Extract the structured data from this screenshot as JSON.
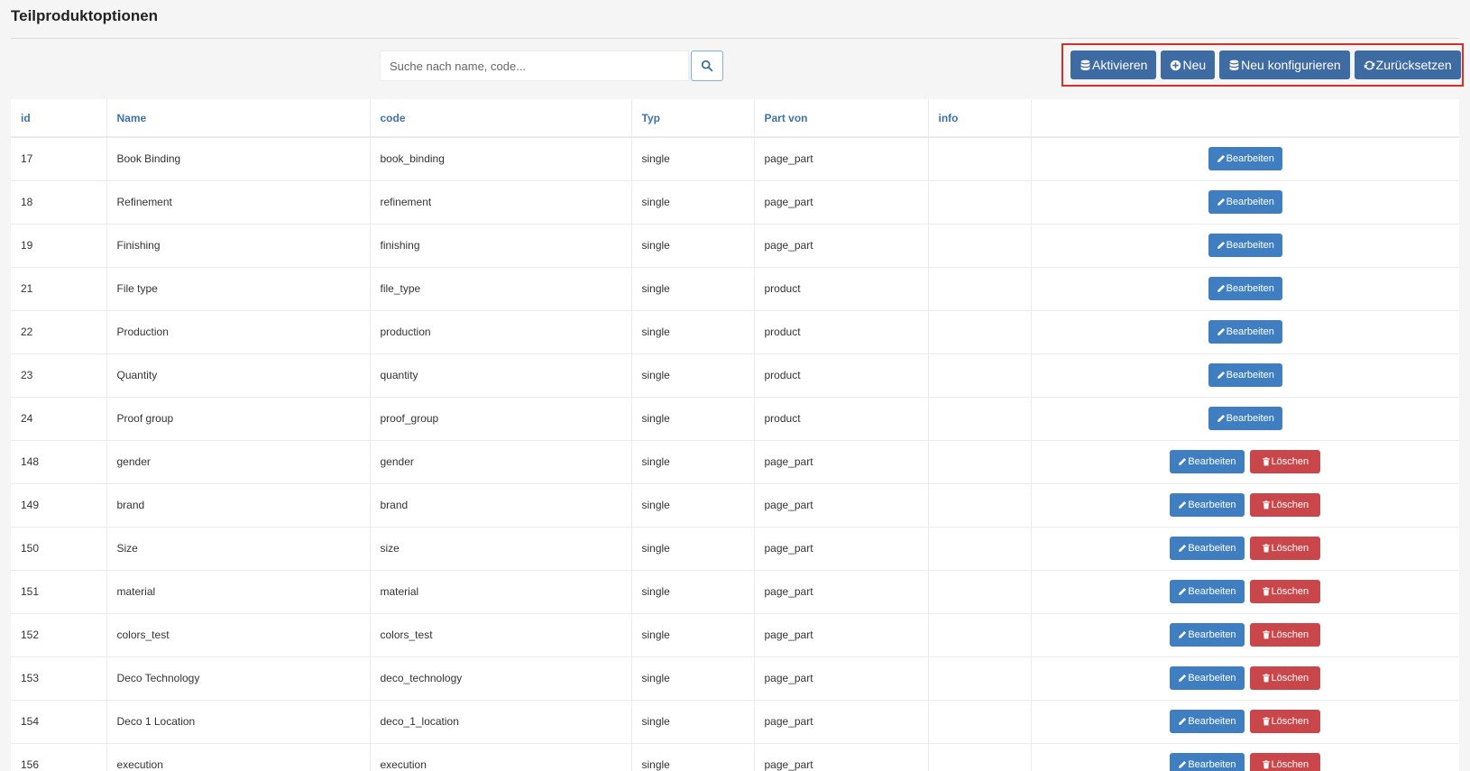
{
  "page": {
    "title": "Teilproduktoptionen"
  },
  "search": {
    "placeholder": "Suche nach name, code..."
  },
  "actions": {
    "activate": "Aktivieren",
    "new": "Neu",
    "reconfigure": "Neu konfigurieren",
    "reset": "Zurücksetzen"
  },
  "table": {
    "headers": [
      "id",
      "Name",
      "code",
      "Typ",
      "Part von",
      "info",
      ""
    ],
    "edit_label": "Bearbeiten",
    "delete_label": "Löschen",
    "rows": [
      {
        "id": "17",
        "name": "Book Binding",
        "code": "book_binding",
        "type": "single",
        "part": "page_part",
        "info": "",
        "deletable": false
      },
      {
        "id": "18",
        "name": "Refinement",
        "code": "refinement",
        "type": "single",
        "part": "page_part",
        "info": "",
        "deletable": false
      },
      {
        "id": "19",
        "name": "Finishing",
        "code": "finishing",
        "type": "single",
        "part": "page_part",
        "info": "",
        "deletable": false
      },
      {
        "id": "21",
        "name": "File type",
        "code": "file_type",
        "type": "single",
        "part": "product",
        "info": "",
        "deletable": false
      },
      {
        "id": "22",
        "name": "Production",
        "code": "production",
        "type": "single",
        "part": "product",
        "info": "",
        "deletable": false
      },
      {
        "id": "23",
        "name": "Quantity",
        "code": "quantity",
        "type": "single",
        "part": "product",
        "info": "",
        "deletable": false
      },
      {
        "id": "24",
        "name": "Proof group",
        "code": "proof_group",
        "type": "single",
        "part": "product",
        "info": "",
        "deletable": false
      },
      {
        "id": "148",
        "name": "gender",
        "code": "gender",
        "type": "single",
        "part": "page_part",
        "info": "",
        "deletable": true
      },
      {
        "id": "149",
        "name": "brand",
        "code": "brand",
        "type": "single",
        "part": "page_part",
        "info": "",
        "deletable": true
      },
      {
        "id": "150",
        "name": "Size",
        "code": "size",
        "type": "single",
        "part": "page_part",
        "info": "",
        "deletable": true
      },
      {
        "id": "151",
        "name": "material",
        "code": "material",
        "type": "single",
        "part": "page_part",
        "info": "",
        "deletable": true
      },
      {
        "id": "152",
        "name": "colors_test",
        "code": "colors_test",
        "type": "single",
        "part": "page_part",
        "info": "",
        "deletable": true
      },
      {
        "id": "153",
        "name": "Deco Technology",
        "code": "deco_technology",
        "type": "single",
        "part": "page_part",
        "info": "",
        "deletable": true
      },
      {
        "id": "154",
        "name": "Deco 1 Location",
        "code": "deco_1_location",
        "type": "single",
        "part": "page_part",
        "info": "",
        "deletable": true
      },
      {
        "id": "156",
        "name": "execution",
        "code": "execution",
        "type": "single",
        "part": "page_part",
        "info": "",
        "deletable": true
      }
    ]
  },
  "icons": {
    "search": "search-icon",
    "database": "database-icon",
    "plus": "plus-circle-icon",
    "refresh": "refresh-icon",
    "edit": "pencil-icon",
    "delete": "trash-icon"
  },
  "colors": {
    "primary": "#3f6ba3",
    "edit": "#3f7fc1",
    "danger": "#c9474b",
    "highlight_border": "#e02b2b",
    "header_text": "#3d72b0"
  }
}
